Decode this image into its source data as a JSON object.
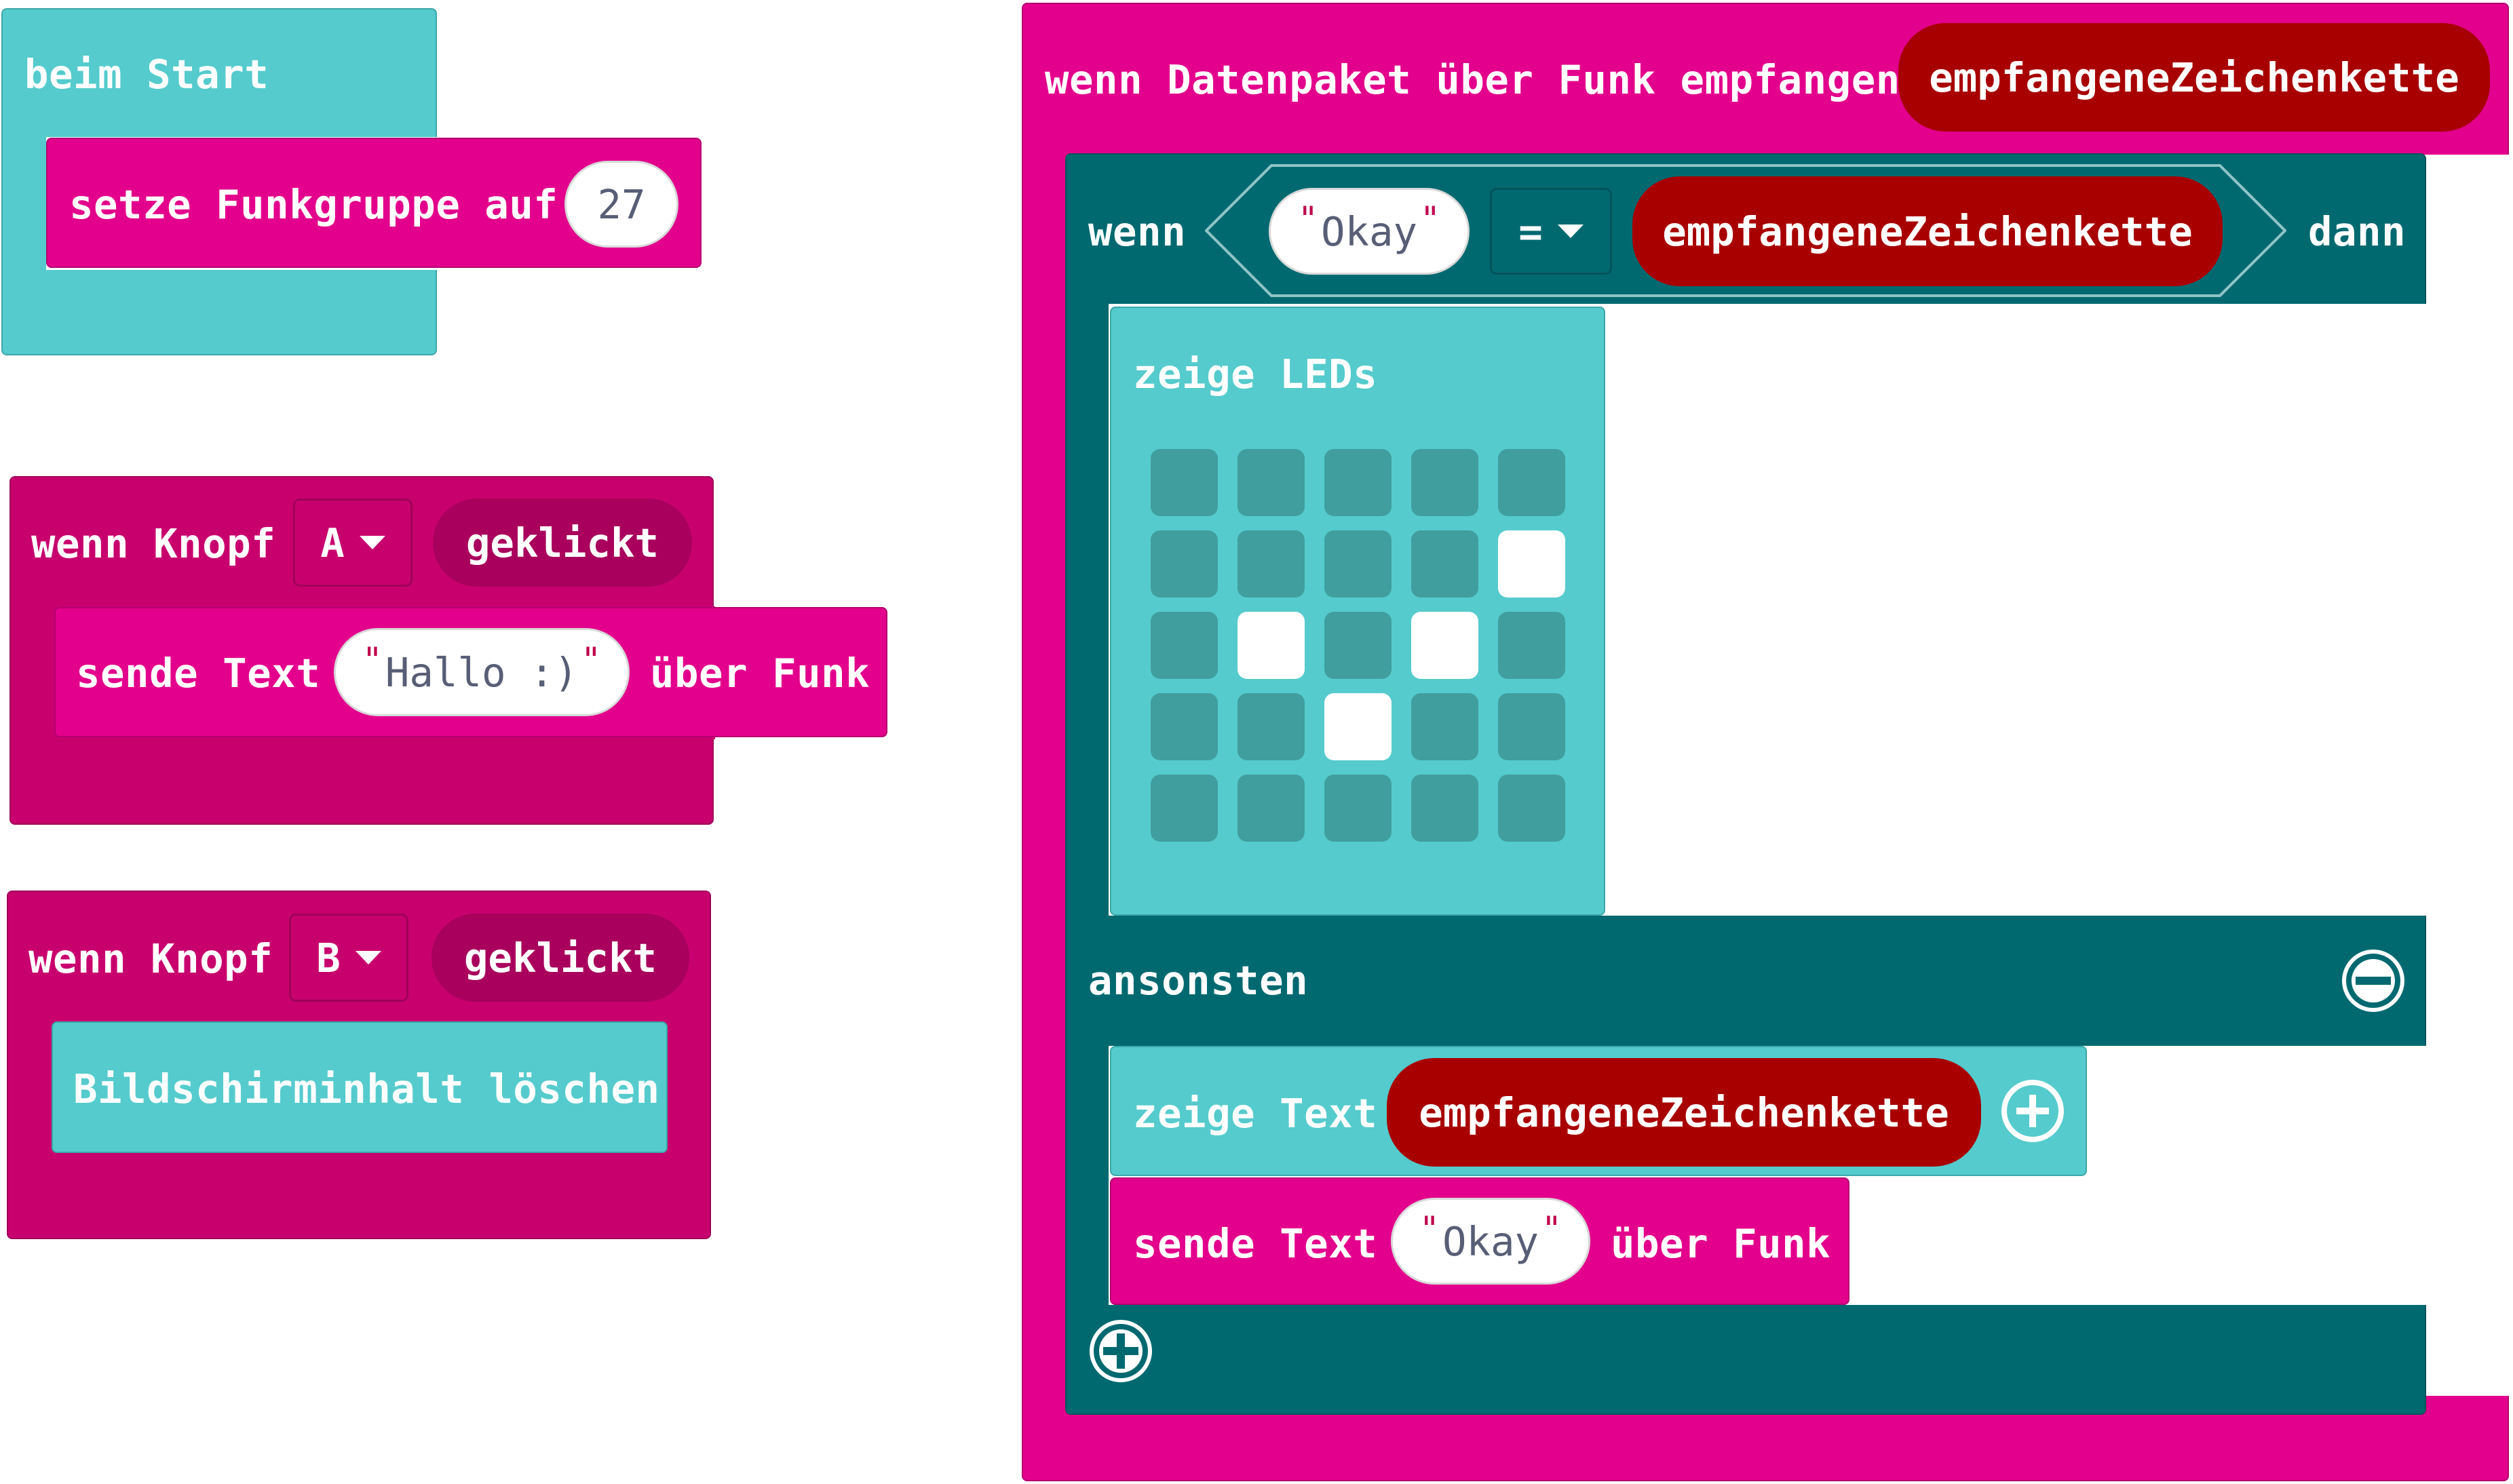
{
  "colors": {
    "basic": "#55cbcd",
    "radio": "#e3008c",
    "input": "#c8006e",
    "logic": "#006970",
    "variable": "#a80000",
    "led_on": "#ffffff",
    "led_off": "#419e9e"
  },
  "on_start": {
    "hat_label": "beim Start",
    "set_group_label": "setze Funkgruppe auf",
    "group_value": "27"
  },
  "button_a": {
    "prefix": "wenn Knopf",
    "button": "A",
    "event": "geklickt",
    "send_prefix": "sende Text",
    "send_value": "Hallo :)",
    "send_suffix": "über Funk"
  },
  "button_b": {
    "prefix": "wenn Knopf",
    "button": "B",
    "event": "geklickt",
    "clear_label": "Bildschirminhalt löschen"
  },
  "radio_receive": {
    "hat_label": "wenn Datenpaket über Funk empfangen",
    "param": "empfangeneZeichenkette",
    "if_label": "wenn",
    "compare_value": "Okay",
    "operator": "=",
    "compare_var": "empfangeneZeichenkette",
    "then_label": "dann",
    "show_leds_label": "zeige LEDs",
    "leds": [
      [
        0,
        0,
        0,
        0,
        0
      ],
      [
        0,
        0,
        0,
        0,
        1
      ],
      [
        0,
        1,
        0,
        1,
        0
      ],
      [
        0,
        0,
        1,
        0,
        0
      ],
      [
        0,
        0,
        0,
        0,
        0
      ]
    ],
    "else_label": "ansonsten",
    "show_text_label": "zeige Text",
    "show_text_var": "empfangeneZeichenkette",
    "send_prefix": "sende Text",
    "send_value": "Okay",
    "send_suffix": "über Funk"
  },
  "icons": [
    "remove-else-icon",
    "add-arg-icon",
    "add-else-if-icon",
    "dropdown-arrow-icon"
  ]
}
